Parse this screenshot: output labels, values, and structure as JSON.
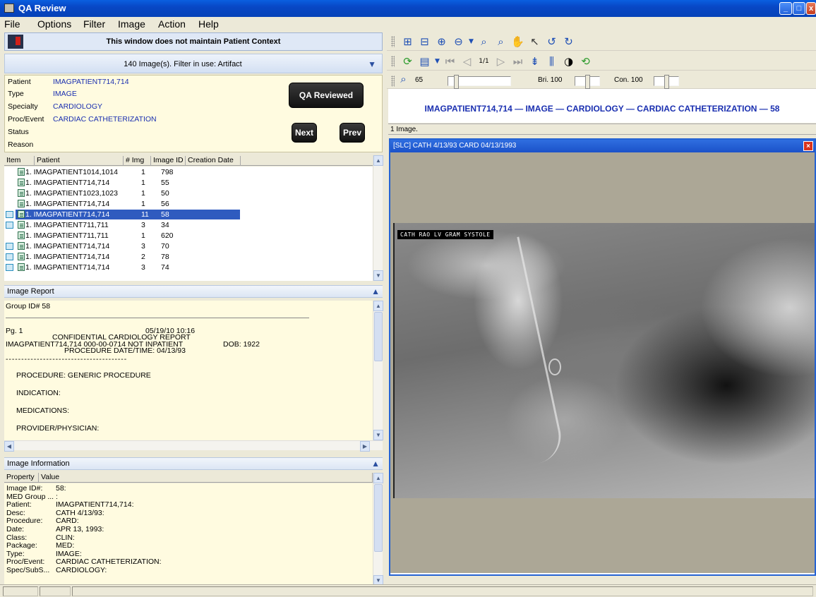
{
  "window": {
    "title": "QA Review",
    "minimize": "_",
    "maximize": "□",
    "close": "x"
  },
  "menu": [
    "File",
    "Options",
    "Filter",
    "Image",
    "Action",
    "Help"
  ],
  "context": {
    "message": "This window does not maintain Patient Context"
  },
  "filter": {
    "summary": "140 Image(s). Filter in use: Artifact"
  },
  "patient_info": {
    "patient_label": "Patient",
    "patient": "IMAGPATIENT714,714",
    "type_label": "Type",
    "type": "IMAGE",
    "specialty_label": "Specialty",
    "specialty": "CARDIOLOGY",
    "proc_label": "Proc/Event",
    "proc": "CARDIAC CATHETERIZATION",
    "status_label": "Status",
    "status": "",
    "reason_label": "Reason",
    "reason": ""
  },
  "buttons": {
    "qa_reviewed": "QA Reviewed",
    "next": "Next",
    "prev": "Prev"
  },
  "list": {
    "headers": [
      "Item",
      "Patient",
      "# Img",
      "Image ID",
      "Creation Date"
    ],
    "rows": [
      {
        "patient": "1. IMAGPATIENT1014,1014",
        "img": "1",
        "id": "798",
        "group": false
      },
      {
        "patient": "1. IMAGPATIENT714,714",
        "img": "1",
        "id": "55",
        "group": false
      },
      {
        "patient": "1. IMAGPATIENT1023,1023",
        "img": "1",
        "id": "50",
        "group": false
      },
      {
        "patient": "1. IMAGPATIENT714,714",
        "img": "1",
        "id": "56",
        "group": false
      },
      {
        "patient": "1. IMAGPATIENT714,714",
        "img": "11",
        "id": "58",
        "group": true
      },
      {
        "patient": "1. IMAGPATIENT711,711",
        "img": "3",
        "id": "34",
        "group": true
      },
      {
        "patient": "1. IMAGPATIENT711,711",
        "img": "1",
        "id": "620",
        "group": false
      },
      {
        "patient": "1. IMAGPATIENT714,714",
        "img": "3",
        "id": "70",
        "group": true
      },
      {
        "patient": "1. IMAGPATIENT714,714",
        "img": "2",
        "id": "78",
        "group": true
      },
      {
        "patient": "1. IMAGPATIENT714,714",
        "img": "3",
        "id": "74",
        "group": true
      }
    ],
    "selected_index": 4
  },
  "report": {
    "header": "Image Report",
    "group_id": "Group ID# 58",
    "page": "Pg. 1",
    "datetime": "05/19/10 10:16",
    "confidential": "CONFIDENTIAL CARDIOLOGY REPORT",
    "patient_line": "IMAGPATIENT714,714   000-00-0714  NOT INPATIENT",
    "dob": "DOB: 1922",
    "proc_date": "PROCEDURE DATE/TIME: 04/13/93",
    "dots": "- - - - - - - - - - - - - - - - - - - - - - - - - - - - - - - - - - - - - - -",
    "procedure": "PROCEDURE:   GENERIC PROCEDURE",
    "indication": "INDICATION:",
    "medications": "MEDICATIONS:",
    "provider": "PROVIDER/PHYSICIAN:"
  },
  "image_info": {
    "header": "Image Information",
    "col_property": "Property",
    "col_value": "Value",
    "rows": [
      {
        "p": "Image ID#:",
        "v": "58:"
      },
      {
        "p": "MED Group ...",
        "v": ":"
      },
      {
        "p": "Patient:",
        "v": "IMAGPATIENT714,714:"
      },
      {
        "p": "Desc:",
        "v": "CATH 4/13/93:"
      },
      {
        "p": "Procedure:",
        "v": "CARD:"
      },
      {
        "p": "   Date:",
        "v": "APR 13, 1993:"
      },
      {
        "p": "Class:",
        "v": "CLIN:"
      },
      {
        "p": "Package:",
        "v": "MED:"
      },
      {
        "p": "Type:",
        "v": "IMAGE:"
      },
      {
        "p": "Proc/Event:",
        "v": "CARDIAC CATHETERIZATION:"
      },
      {
        "p": "Spec/SubS...",
        "v": "CARDIOLOGY:"
      }
    ]
  },
  "toolbar": {
    "zoom_value": "65",
    "brightness_label": "Bri. 100",
    "contrast_label": "Con. 100",
    "page_indicator": "1/1"
  },
  "viewer": {
    "banner": "IMAGPATIENT714,714 — IMAGE — CARDIOLOGY — CARDIAC CATHETERIZATION — 58",
    "count": "1 Image.",
    "window_title": "[SLC] CATH 4/13/93 CARD 04/13/1993",
    "overlay": "CATH  RAO LV GRAM SYSTOLE"
  }
}
